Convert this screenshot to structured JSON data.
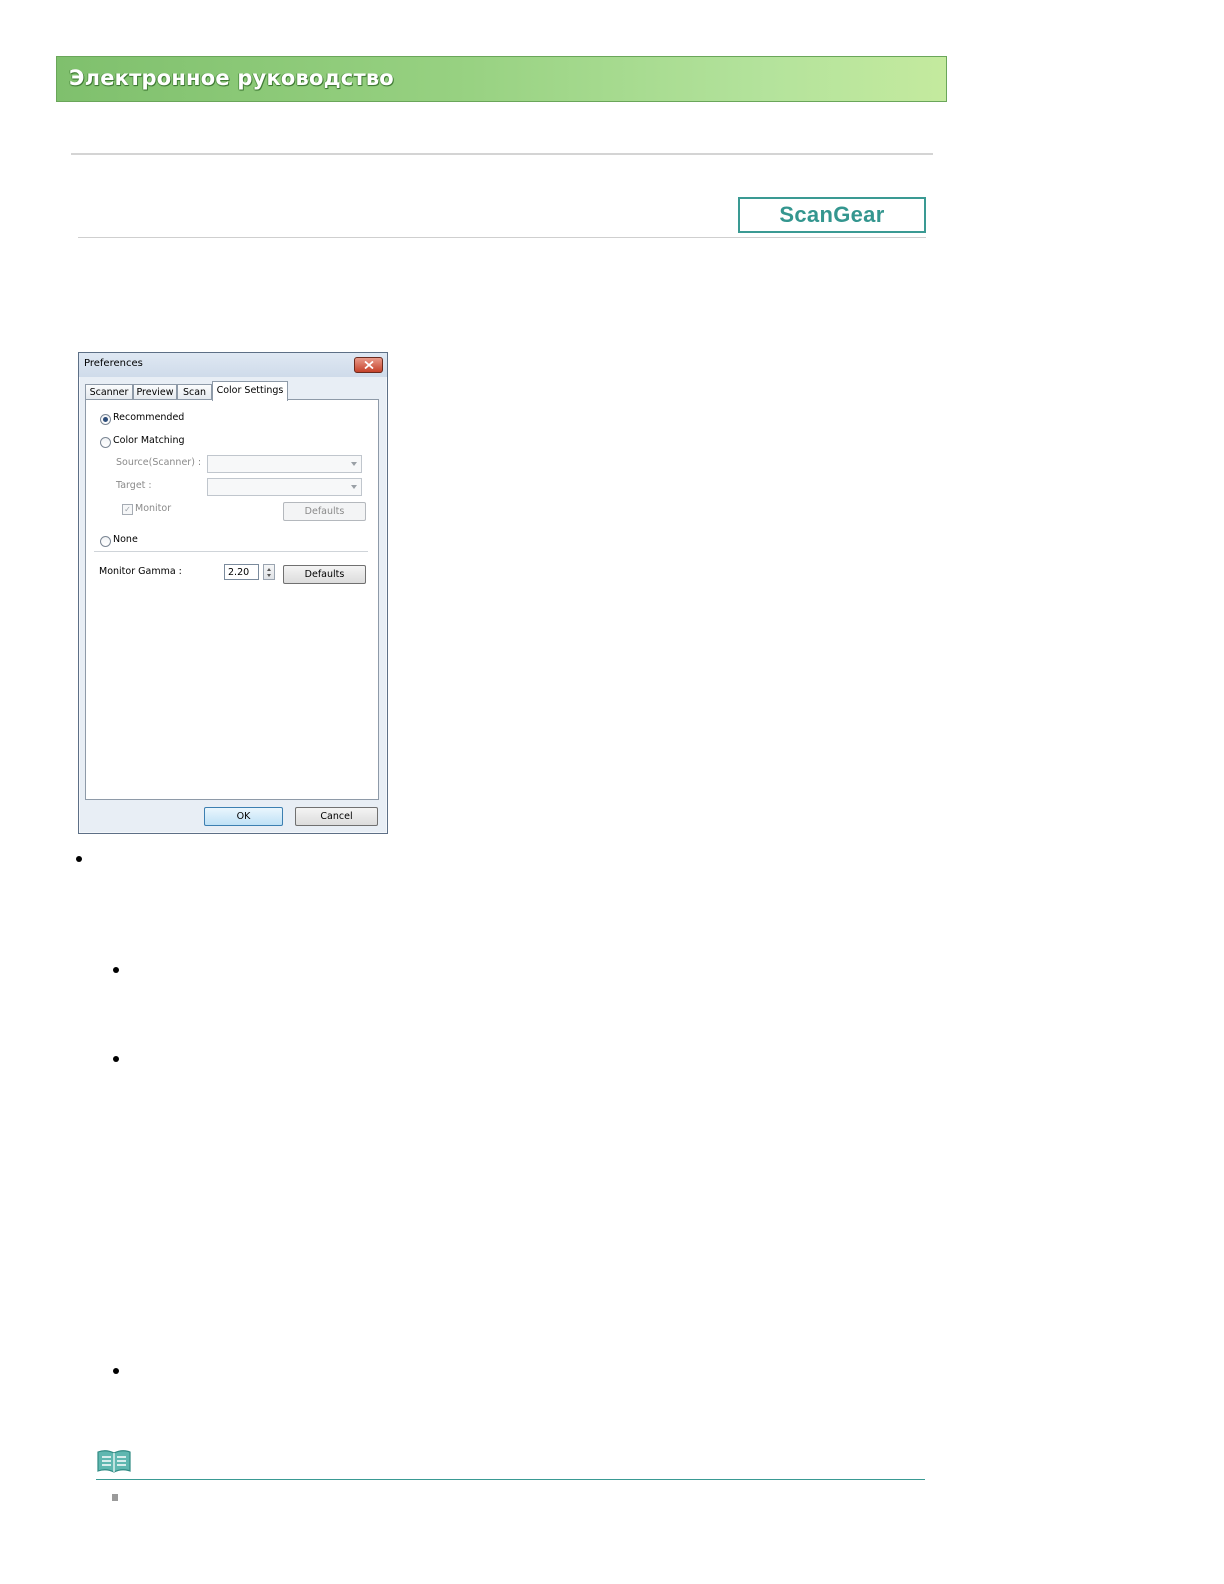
{
  "banner": {
    "title": "Электронное руководство"
  },
  "badge": {
    "label": "ScanGear"
  },
  "dialog": {
    "title": "Preferences",
    "tabs": [
      {
        "label": "Scanner"
      },
      {
        "label": "Preview"
      },
      {
        "label": "Scan"
      },
      {
        "label": "Color Settings",
        "active": true
      }
    ],
    "options": {
      "recommended": "Recommended",
      "color_matching": "Color Matching",
      "source_label": "Source(Scanner) :",
      "target_label": "Target :",
      "monitor_label": "Monitor",
      "monitor_check_glyph": "✓",
      "cm_defaults": "Defaults",
      "none": "None",
      "selected": "recommended"
    },
    "gamma": {
      "label": "Monitor Gamma :",
      "value": "2.20",
      "defaults": "Defaults"
    },
    "buttons": {
      "ok": "OK",
      "cancel": "Cancel"
    }
  },
  "colors": {
    "banner_green": "#97d181",
    "accent_teal": "#34968f"
  },
  "icons": {
    "close": "close-icon",
    "note": "book-note-icon"
  }
}
